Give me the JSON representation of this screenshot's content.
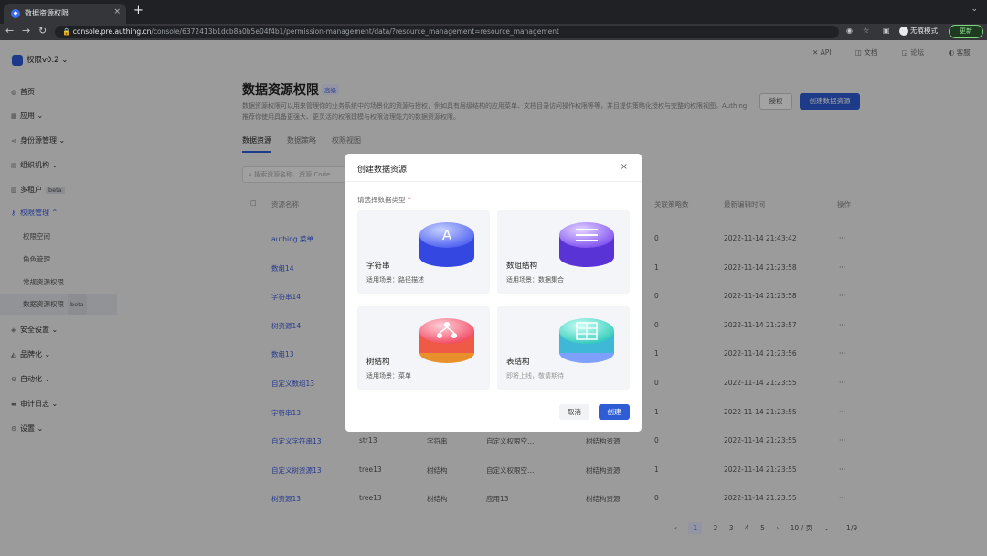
{
  "browser": {
    "tab_title": "数据资源权限",
    "tab_close": "×",
    "new_tab": "+",
    "url_host": "console.pre.authing.cn",
    "url_path": "/console/6372413b1dcb8a0b5e04f4b1/permission-management/data/?resource_management=resource_management",
    "profile_label": "无痕模式",
    "update_label": "更新"
  },
  "sidebar": {
    "app_name": "权限v0.2",
    "items": [
      {
        "label": "首页"
      },
      {
        "label": "应用"
      },
      {
        "label": "身份源管理"
      },
      {
        "label": "组织机构"
      },
      {
        "label": "多租户",
        "badge": "beta"
      },
      {
        "label": "权限管理"
      },
      {
        "label": "安全设置"
      },
      {
        "label": "品牌化"
      },
      {
        "label": "自动化"
      },
      {
        "label": "审计日志"
      },
      {
        "label": "设置"
      }
    ],
    "sub_items": [
      {
        "label": "权限空间"
      },
      {
        "label": "角色管理"
      },
      {
        "label": "常规资源权限"
      },
      {
        "label": "数据资源权限",
        "badge": "beta"
      }
    ]
  },
  "top_links": [
    "API",
    "文档",
    "论坛",
    "客服"
  ],
  "page": {
    "title": "数据资源权限",
    "title_tag": "高级",
    "description": "数据资源权限可以用来管理你的业务系统中的场景化的资源与授权，例如具有层级结构的应用菜单、文档目录访问操作权限等等，并且提供策略化授权与完整的权限视图。Authing 推荐你使用具备更强大、更灵活的权限建模与权限治理能力的数据资源权限。",
    "authorize_button": "授权",
    "create_button": "创建数据资源",
    "tabs": [
      "数据资源",
      "数据策略",
      "权限视图"
    ],
    "search_placeholder": "搜索资源名称、资源 Code"
  },
  "table": {
    "headers": [
      "资源名称",
      "关联策略数",
      "最新编辑时间",
      "操作"
    ],
    "rows": [
      {
        "name": "authing 菜单",
        "code": "",
        "type": "",
        "space": "",
        "category": "",
        "count": "0",
        "time": "2022-11-14 21:43:42",
        "op": "···"
      },
      {
        "name": "数组14",
        "code": "",
        "type": "",
        "space": "",
        "category": "",
        "count": "1",
        "time": "2022-11-14 21:23:58",
        "op": "···"
      },
      {
        "name": "字符串14",
        "code": "",
        "type": "",
        "space": "",
        "category": "",
        "count": "0",
        "time": "2022-11-14 21:23:58",
        "op": "···"
      },
      {
        "name": "树资源14",
        "code": "",
        "type": "",
        "space": "",
        "category": "",
        "count": "0",
        "time": "2022-11-14 21:23:57",
        "op": "···"
      },
      {
        "name": "数组13",
        "code": "",
        "type": "",
        "space": "",
        "category": "",
        "count": "1",
        "time": "2022-11-14 21:23:56",
        "op": "···"
      },
      {
        "name": "自定义数组13",
        "code": "",
        "type": "",
        "space": "",
        "category": "",
        "count": "0",
        "time": "2022-11-14 21:23:55",
        "op": "···"
      },
      {
        "name": "字符串13",
        "code": "",
        "type": "",
        "space": "",
        "category": "",
        "count": "1",
        "time": "2022-11-14 21:23:55",
        "op": "···"
      },
      {
        "name": "自定义字符串13",
        "code": "str13",
        "type": "字符串",
        "space": "自定义权限空…",
        "category": "树结构资源",
        "count": "0",
        "time": "2022-11-14 21:23:55",
        "op": "···"
      },
      {
        "name": "自定义树资源13",
        "code": "tree13",
        "type": "树结构",
        "space": "自定义权限空…",
        "category": "树结构资源",
        "count": "1",
        "time": "2022-11-14 21:23:55",
        "op": "···"
      },
      {
        "name": "树资源13",
        "code": "tree13",
        "type": "树结构",
        "space": "应用13",
        "category": "树结构资源",
        "count": "0",
        "time": "2022-11-14 21:23:55",
        "op": "···"
      }
    ]
  },
  "pagination": {
    "prev": "‹",
    "pages": [
      "1",
      "2",
      "3",
      "4",
      "5"
    ],
    "next": "›",
    "page_size": "10 / 页",
    "summary": "1/9"
  },
  "modal": {
    "title": "创建数据资源",
    "close": "×",
    "field_label": "请选择数据类型",
    "required_mark": "*",
    "options": [
      {
        "name": "字符串",
        "scenario": "适用场景：路径描述",
        "icon": "string-icon",
        "color": "#4a5cf0"
      },
      {
        "name": "数组结构",
        "scenario": "适用场景：数据集合",
        "icon": "array-icon",
        "color": "#7b4cf0"
      },
      {
        "name": "树结构",
        "scenario": "适用场景：菜单",
        "icon": "tree-icon",
        "color": "#f0445c"
      },
      {
        "name": "表结构",
        "scenario": "即将上线，敬请期待",
        "icon": "table-icon",
        "color": "#2cc9b8"
      }
    ],
    "cancel": "取消",
    "confirm": "创建"
  }
}
